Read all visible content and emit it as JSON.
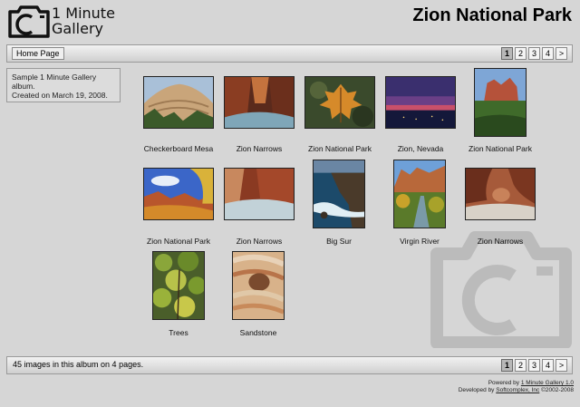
{
  "header": {
    "logo_line1": "1 Minute",
    "logo_line2": "Gallery",
    "album_title": "Zion National Park",
    "logo_icon": "camera-icon"
  },
  "nav": {
    "home_label": "Home Page",
    "pages": [
      "1",
      "2",
      "3",
      "4",
      ">"
    ],
    "current_page": "1"
  },
  "description": {
    "line1": "Sample 1 Minute Gallery album.",
    "line2": "Created on March 19, 2008."
  },
  "gallery": {
    "items": [
      {
        "caption": "Checkerboard Mesa"
      },
      {
        "caption": "Zion Narrows"
      },
      {
        "caption": "Zion National Park"
      },
      {
        "caption": "Zion, Nevada"
      },
      {
        "caption": "Zion National Park"
      },
      {
        "caption": "Zion National Park"
      },
      {
        "caption": "Zion Narrows"
      },
      {
        "caption": "Big Sur"
      },
      {
        "caption": "Virgin River"
      },
      {
        "caption": "Zion Narrows"
      },
      {
        "caption": "Trees"
      },
      {
        "caption": "Sandstone"
      }
    ]
  },
  "footer_bar": {
    "info": "45 images in this album on 4 pages."
  },
  "credits": {
    "powered_prefix": "Powered by ",
    "powered_link": "1 Minute Gallery 1.0",
    "developed_prefix": "Developed by ",
    "developed_link": "Softcomplex, Inc",
    "developed_suffix": " ©2002-2008"
  },
  "colors": {
    "background": "#d6d6d6",
    "bar_border": "#9a9a9a"
  }
}
